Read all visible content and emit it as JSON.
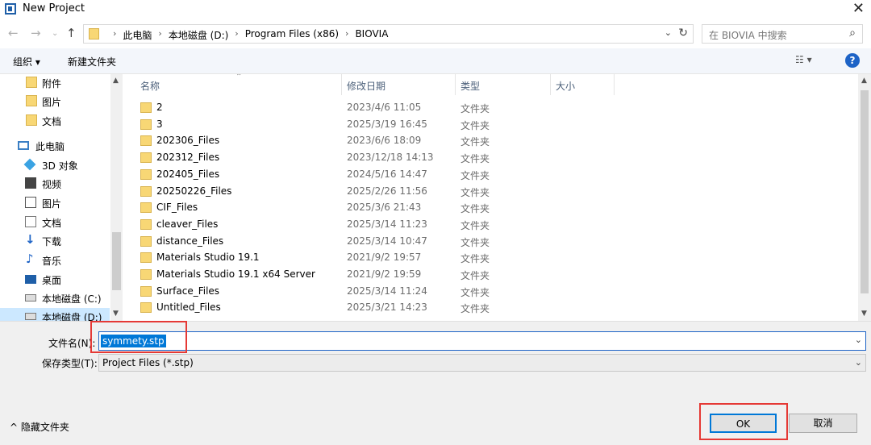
{
  "window": {
    "title": "New Project"
  },
  "address": {
    "crumbs": [
      "此电脑",
      "本地磁盘 (D:)",
      "Program Files (x86)",
      "BIOVIA"
    ]
  },
  "search": {
    "placeholder": "在 BIOVIA 中搜索"
  },
  "toolbar": {
    "organize": "组织 ▾",
    "new_folder": "新建文件夹",
    "help": "?"
  },
  "nav": {
    "items": [
      {
        "label": "附件",
        "icon": "folder-icon"
      },
      {
        "label": "图片",
        "icon": "folder-icon"
      },
      {
        "label": "文档",
        "icon": "folder-icon"
      },
      {
        "label": "此电脑",
        "icon": "computer-icon"
      },
      {
        "label": "3D 对象",
        "icon": "3d-objects-icon"
      },
      {
        "label": "视频",
        "icon": "video-icon"
      },
      {
        "label": "图片",
        "icon": "pictures-icon"
      },
      {
        "label": "文档",
        "icon": "documents-icon"
      },
      {
        "label": "下载",
        "icon": "download-icon"
      },
      {
        "label": "音乐",
        "icon": "music-icon"
      },
      {
        "label": "桌面",
        "icon": "desktop-icon"
      },
      {
        "label": "本地磁盘 (C:)",
        "icon": "drive-icon"
      },
      {
        "label": "本地磁盘 (D:)",
        "icon": "drive-icon"
      }
    ]
  },
  "columns": {
    "name": "名称",
    "date": "修改日期",
    "type": "类型",
    "size": "大小"
  },
  "files": [
    {
      "name": "2",
      "date": "2023/4/6 11:05",
      "type": "文件夹"
    },
    {
      "name": "3",
      "date": "2025/3/19 16:45",
      "type": "文件夹"
    },
    {
      "name": "202306_Files",
      "date": "2023/6/6 18:09",
      "type": "文件夹"
    },
    {
      "name": "202312_Files",
      "date": "2023/12/18 14:13",
      "type": "文件夹"
    },
    {
      "name": "202405_Files",
      "date": "2024/5/16 14:47",
      "type": "文件夹"
    },
    {
      "name": "20250226_Files",
      "date": "2025/2/26 11:56",
      "type": "文件夹"
    },
    {
      "name": "CIF_Files",
      "date": "2025/3/6 21:43",
      "type": "文件夹"
    },
    {
      "name": "cleaver_Files",
      "date": "2025/3/14 11:23",
      "type": "文件夹"
    },
    {
      "name": "distance_Files",
      "date": "2025/3/14 10:47",
      "type": "文件夹"
    },
    {
      "name": "Materials Studio 19.1",
      "date": "2021/9/2 19:57",
      "type": "文件夹"
    },
    {
      "name": "Materials Studio 19.1 x64 Server",
      "date": "2021/9/2 19:59",
      "type": "文件夹"
    },
    {
      "name": "Surface_Files",
      "date": "2025/3/14 11:24",
      "type": "文件夹"
    },
    {
      "name": "Untitled_Files",
      "date": "2025/3/21 14:23",
      "type": "文件夹"
    }
  ],
  "bottom": {
    "filename_label": "文件名(N):",
    "filename_value": "symmety.stp",
    "filetype_label": "保存类型(T):",
    "filetype_value": "Project Files (*.stp)",
    "hide_folders": "隐藏文件夹",
    "ok": "OK",
    "cancel": "取消"
  }
}
